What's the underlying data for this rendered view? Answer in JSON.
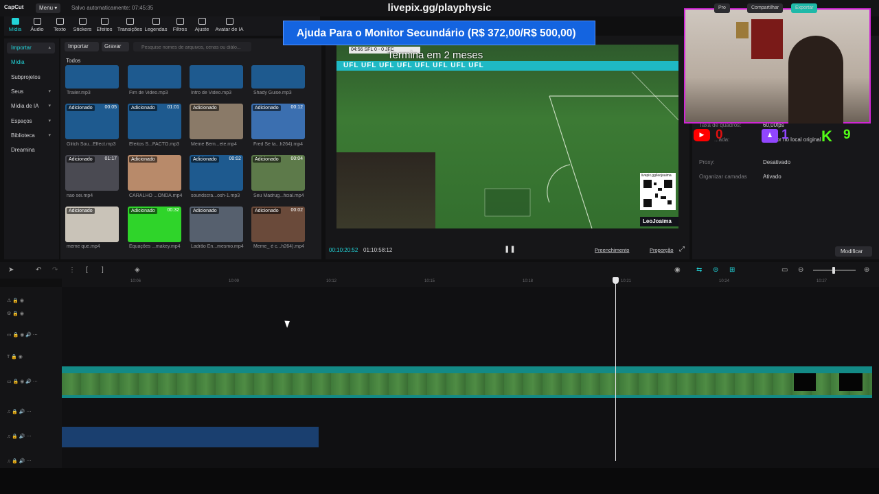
{
  "topbar": {
    "logo": "CapCut",
    "menu": "Menu ▾",
    "autosave": "Salvo automaticamente: 07:45:35",
    "title": "livepix.gg/playphysic",
    "right_buttons": [
      "Pro",
      "Compartilhar",
      "Exportar"
    ]
  },
  "toolbar": {
    "items": [
      "Mídia",
      "Áudio",
      "Texto",
      "Stickers",
      "Efeitos",
      "Transições",
      "Legendas",
      "Filtros",
      "Ajuste",
      "Avatar de IA"
    ]
  },
  "sidebar": {
    "items": [
      "Importar",
      "Mídia",
      "Subprojetos",
      "Seus",
      "Mídia de IA",
      "Espaços",
      "Biblioteca",
      "Dreamina"
    ]
  },
  "media": {
    "import_label": "Importar",
    "record_label": "Gravar",
    "search_placeholder": "Pesquise nomes de arquivos, cenas ou diálo...",
    "section_label": "Todos",
    "badge": "Adicionado",
    "row1": [
      "Trailer.mp3",
      "Fim de Video.mp3",
      "Intro de Video.mp3",
      "Shady Guise.mp3"
    ],
    "row2": [
      {
        "label": "Glitch Sou...Effect.mp3",
        "dur": "00:05"
      },
      {
        "label": "Efeitos S...PACTO.mp3",
        "dur": "01:01"
      },
      {
        "label": "Meme Bem...ete.mp4",
        "dur": ""
      },
      {
        "label": "Fred Se ta...h264).mp4",
        "dur": "00:12"
      }
    ],
    "row3": [
      {
        "label": "nao sei.mp4",
        "dur": "01:17"
      },
      {
        "label": "CARALHO ...ONDA.mp4",
        "dur": ""
      },
      {
        "label": "soundscra...osh-1.mp3",
        "dur": "00:02"
      },
      {
        "label": "Seu Madrug...ficial.mp4",
        "dur": "00:04"
      }
    ],
    "row4": [
      {
        "label": "meme que.mp4",
        "dur": ""
      },
      {
        "label": "Equações ...makey.mp4",
        "dur": "00:32"
      },
      {
        "label": "Ladrão En...mesmo.mp4",
        "dur": ""
      },
      {
        "label": "Meme_ é c...h264).mp4",
        "dur": "00:02"
      }
    ]
  },
  "player": {
    "banner": "Ajuda Para o Monitor Secundário (R$ 372,00/R$ 500,00)",
    "countdown": "Termina em 2 meses",
    "scoreboard": "04:56  SFL  0 - 0  JFC",
    "band": "UFL   UFL   UFL   UFL   UFL   UFL   UFL   UFL",
    "qr_label": "livepix.gg/leojoaima",
    "channel": "LeoJoaima",
    "timecode": "00:10:20:52",
    "duration": "01:10:58:12",
    "ctl_fill": "Preenchimento",
    "ctl_ratio": "Proporção"
  },
  "props": {
    "frame_rate_label": "Taxa de quadros:",
    "frame_rate_value": "60,00fps",
    "local_label": "...ada:",
    "local_value": "...or no local original",
    "proxy_label": "Proxy:",
    "proxy_value": "Desativado",
    "layers_label": "Organizar camadas",
    "layers_value": "Ativado",
    "modify": "Modificar"
  },
  "scores": {
    "youtube_icon": "▶",
    "youtube": "0",
    "twitch_icon": "♟",
    "twitch": "1",
    "kick_icon": "K",
    "kick": "9"
  },
  "timeline": {
    "ticks": [
      "10:06",
      "10:09",
      "10:12",
      "10:15",
      "10:18",
      "10:21",
      "10:24",
      "10:27"
    ]
  }
}
